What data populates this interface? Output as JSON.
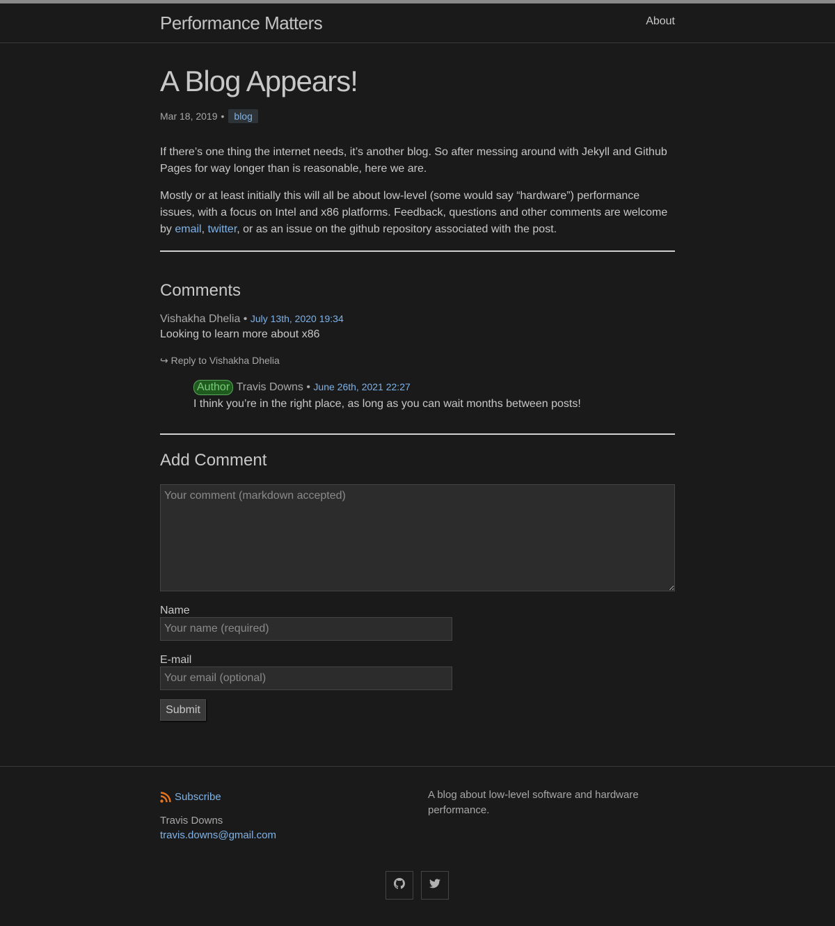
{
  "header": {
    "site_title": "Performance Matters",
    "nav_about": "About"
  },
  "post": {
    "title": "A Blog Appears!",
    "date": "Mar 18, 2019",
    "meta_separator": "•",
    "tag": "blog",
    "paragraph1": "If there’s one thing the internet needs, it’s another blog. So after messing around with Jekyll and Github Pages for way longer than is reasonable, here we are.",
    "paragraph2_prefix": "Mostly or at least initially this will all be about low-level (some would say “hardware”) performance issues, with a focus on Intel and x86 platforms. Feedback, questions and other comments are welcome by ",
    "paragraph2_link_email": "email",
    "paragraph2_comma": ", ",
    "paragraph2_link_twitter": "twitter",
    "paragraph2_suffix": ", or as an issue on the github repository associated with the post."
  },
  "comments": {
    "heading": "Comments",
    "items": [
      {
        "author": "Vishakha Dhelia",
        "separator": "•",
        "date": "July 13th, 2020 19:34",
        "text": "Looking to learn more about x86",
        "reply_label": "↪ Reply to Vishakha Dhelia"
      },
      {
        "badge": "Author",
        "author": "Travis Downs",
        "separator": "•",
        "date": "June 26th, 2021 22:27",
        "text": "I think you’re in the right place, as long as you can wait months between posts!"
      }
    ]
  },
  "add_comment": {
    "heading": "Add Comment",
    "comment_placeholder": "Your comment (markdown accepted)",
    "name_label": "Name",
    "name_placeholder": "Your name (required)",
    "email_label": "E-mail",
    "email_placeholder": "Your email (optional)",
    "submit_label": "Submit"
  },
  "footer": {
    "subscribe": "Subscribe",
    "author_name": "Travis Downs",
    "author_email": "travis.downs@gmail.com",
    "description": "A blog about low-level software and hardware performance.",
    "social": [
      {
        "icon": "github-icon"
      },
      {
        "icon": "twitter-icon"
      }
    ]
  },
  "colors": {
    "background": "#1a1a1a",
    "link": "#7fb3e8",
    "rss": "#e8731e",
    "author_badge": "#1f5a1f"
  }
}
